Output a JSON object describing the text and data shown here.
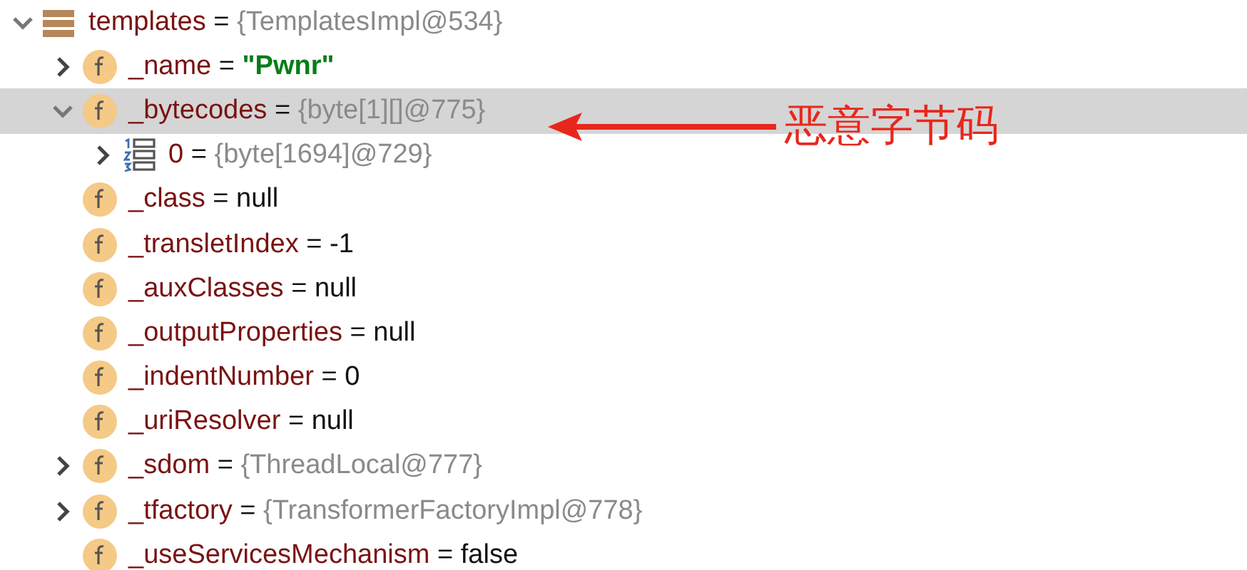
{
  "tree": [
    {
      "kind": "object",
      "name": "templates",
      "operator": "=",
      "value": "{TemplatesImpl@534}",
      "expanded": true,
      "selected": false,
      "children": [
        {
          "kind": "string_field",
          "name": "_name",
          "operator": "=",
          "value": "\"Pwnr\"",
          "expanded": false,
          "selected": false
        },
        {
          "kind": "object_field",
          "name": "_bytecodes",
          "operator": "=",
          "value": "{byte[1][]@775}",
          "expanded": true,
          "selected": true,
          "children": [
            {
              "kind": "array_element",
              "name": "0",
              "operator": "=",
              "value": "{byte[1694]@729}",
              "expanded": false,
              "selected": false
            }
          ]
        },
        {
          "kind": "primitive_field",
          "name": "_class",
          "operator": "=",
          "value": "null",
          "selected": false
        },
        {
          "kind": "primitive_field",
          "name": "_transletIndex",
          "operator": "=",
          "value": "-1",
          "selected": false
        },
        {
          "kind": "primitive_field",
          "name": "_auxClasses",
          "operator": "=",
          "value": "null",
          "selected": false
        },
        {
          "kind": "primitive_field",
          "name": "_outputProperties",
          "operator": "=",
          "value": "null",
          "selected": false
        },
        {
          "kind": "primitive_field",
          "name": "_indentNumber",
          "operator": "=",
          "value": "0",
          "selected": false
        },
        {
          "kind": "primitive_field",
          "name": "_uriResolver",
          "operator": "=",
          "value": "null",
          "selected": false
        },
        {
          "kind": "object_field",
          "name": "_sdom",
          "operator": "=",
          "value": "{ThreadLocal@777}",
          "expanded": false,
          "selected": false
        },
        {
          "kind": "object_field",
          "name": "_tfactory",
          "operator": "=",
          "value": "{TransformerFactoryImpl@778}",
          "expanded": false,
          "selected": false
        },
        {
          "kind": "primitive_field",
          "name": "_useServicesMechanism",
          "operator": "=",
          "value": "false",
          "selected": false
        }
      ]
    }
  ],
  "annotation": {
    "text": "恶意字节码"
  }
}
